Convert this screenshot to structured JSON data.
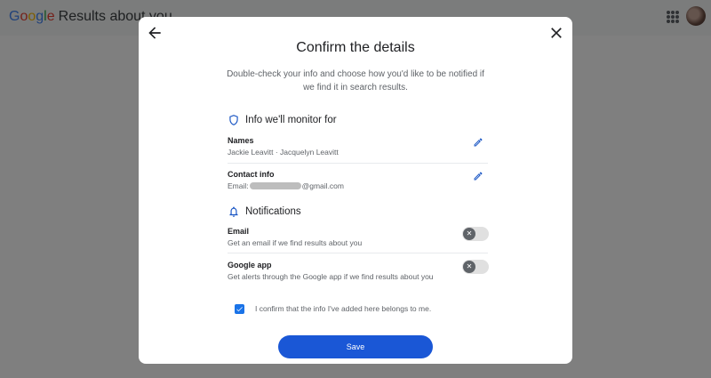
{
  "app": {
    "brand_letters": [
      "G",
      "o",
      "o",
      "g",
      "l",
      "e"
    ],
    "brand_colors": [
      "#4285f4",
      "#ea4335",
      "#fbbc05",
      "#4285f4",
      "#34a853",
      "#ea4335"
    ],
    "page_title": "Results about you"
  },
  "dialog": {
    "title": "Confirm the details",
    "subtitle": "Double-check your info and choose how you'd like to be notified if we find it in search results.",
    "monitor_section": {
      "heading": "Info we'll monitor for",
      "names_label": "Names",
      "names_value": "Jackie Leavitt · Jacquelyn Leavitt",
      "contact_label": "Contact info",
      "contact_prefix": "Email:",
      "contact_suffix": "@gmail.com"
    },
    "notifications_section": {
      "heading": "Notifications",
      "email_label": "Email",
      "email_desc": "Get an email if we find results about you",
      "email_enabled": false,
      "app_label": "Google app",
      "app_desc": "Get alerts through the Google app if we find results about you",
      "app_enabled": false
    },
    "confirm_text": "I confirm that the info I've added here belongs to me.",
    "confirm_checked": true,
    "save_label": "Save"
  },
  "colors": {
    "accent": "#1a57d6",
    "checkbox": "#1a73e8",
    "icon_blue": "#1a56c4"
  }
}
